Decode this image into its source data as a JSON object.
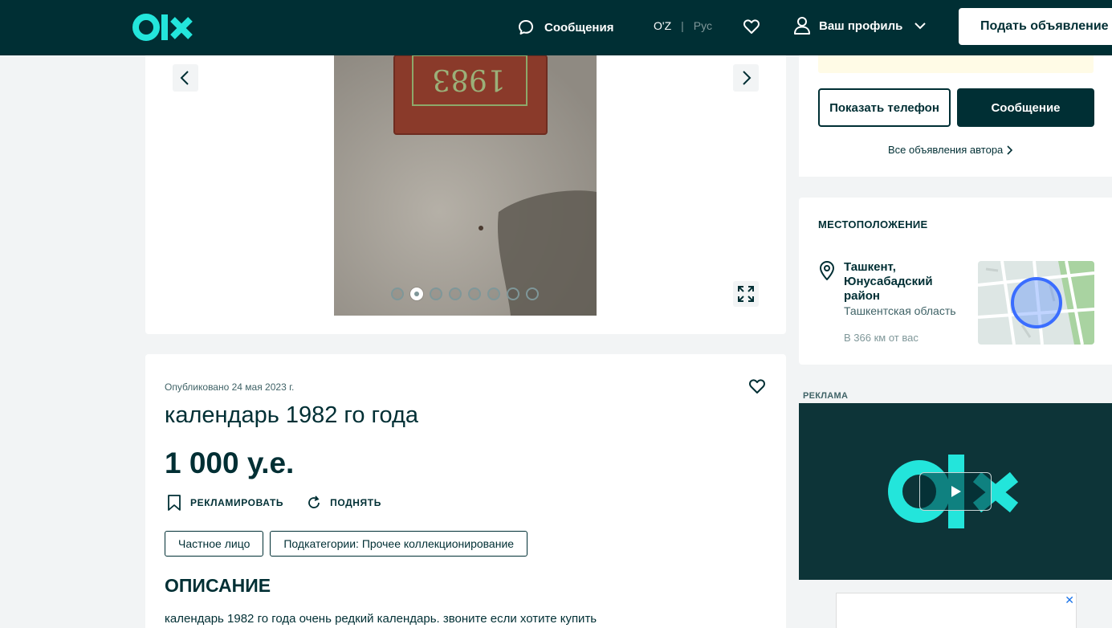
{
  "header": {
    "logo_text": "olx",
    "messages_label": "Сообщения",
    "lang_uz": "O'Z",
    "lang_sep": "|",
    "lang_ru": "Рус",
    "profile_label": "Ваш профиль",
    "post_button": "Подать объявление",
    "colors": {
      "bg": "#002f34",
      "logo": "#23e5db"
    }
  },
  "gallery": {
    "photo_count": 8,
    "active_index": 1,
    "calendar_year_text": "1983"
  },
  "listing": {
    "published": "Опубликовано 24 мая 2023 г.",
    "title": "календарь 1982 го года",
    "price": "1 000 у.е.",
    "promote_label": "РЕКЛАМИРОВАТЬ",
    "raise_label": "ПОДНЯТЬ",
    "tags": [
      "Частное лицо",
      "Подкатегории: Прочее коллекционирование"
    ],
    "description_heading": "ОПИСАНИЕ",
    "description": "календарь 1982 го года очень редкий календарь. звоните если хотите купить"
  },
  "seller": {
    "show_phone": "Показать телефон",
    "message": "Сообщение",
    "all_ads": "Все объявления автора"
  },
  "location": {
    "heading": "МЕСТОПОЛОЖЕНИЕ",
    "city": "Ташкент, Юнусабадский район",
    "region": "Ташкентская область",
    "distance": "В 366 км от вас"
  },
  "ads": {
    "label": "РЕКЛАМА",
    "close": "✕"
  }
}
